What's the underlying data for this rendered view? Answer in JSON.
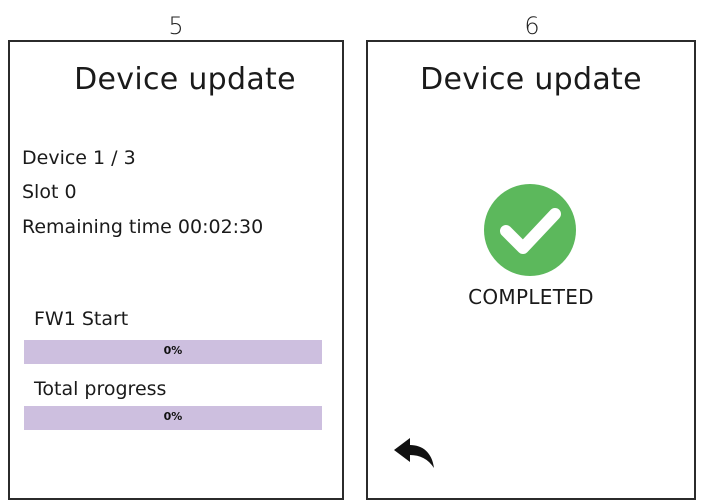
{
  "steps": [
    {
      "number": "5",
      "title": "Device update",
      "device": "Device 1 / 3",
      "slot": "Slot 0",
      "remaining": "Remaining time 00:02:30",
      "progress_items": [
        {
          "label": "FW1 Start",
          "value": 0,
          "text": "0%"
        },
        {
          "label": "Total progress",
          "value": 0,
          "text": "0%"
        }
      ]
    },
    {
      "number": "6",
      "title": "Device update",
      "status_icon": "check-circle-icon",
      "status": "COMPLETED",
      "back_icon": "back-arrow-icon"
    }
  ],
  "colors": {
    "progress_track": "#cdbfdf",
    "success": "#5cb85c",
    "border": "#2b2b2b"
  }
}
